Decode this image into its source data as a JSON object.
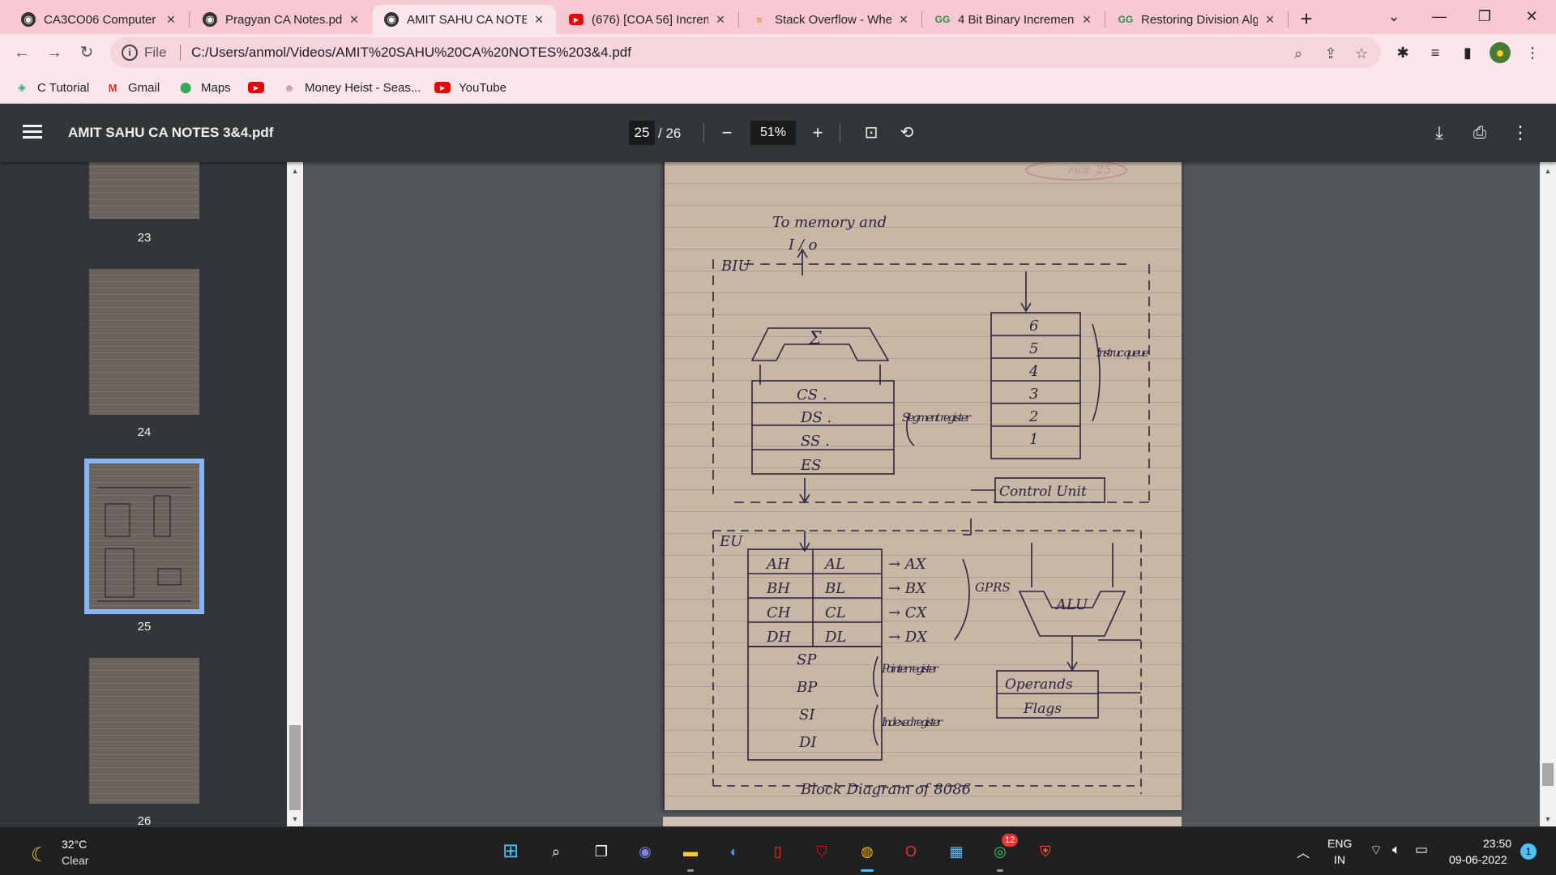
{
  "tabs": [
    {
      "title": "CA3CO06 Computer A",
      "icon": "globe-icon"
    },
    {
      "title": "Pragyan CA Notes.pdf",
      "icon": "globe-icon"
    },
    {
      "title": "AMIT SAHU CA NOTE",
      "icon": "globe-icon",
      "active": true
    },
    {
      "title": "(676) [COA 56] Increm",
      "icon": "youtube-icon"
    },
    {
      "title": "Stack Overflow - Whe",
      "icon": "stackoverflow-icon"
    },
    {
      "title": "4 Bit Binary Increment",
      "icon": "geeksforgeeks-icon"
    },
    {
      "title": "Restoring Division Alg",
      "icon": "geeksforgeeks-icon"
    }
  ],
  "omnibox": {
    "scheme": "File",
    "url": "C:/Users/anmol/Videos/AMIT%20SAHU%20CA%20NOTES%203&4.pdf"
  },
  "bookmarks": [
    {
      "label": "C Tutorial",
      "icon": "ctutorial-icon"
    },
    {
      "label": "Gmail",
      "icon": "gmail-icon"
    },
    {
      "label": "Maps",
      "icon": "maps-icon"
    },
    {
      "label": "",
      "icon": "youtube-icon"
    },
    {
      "label": "Money Heist - Seas...",
      "icon": "site-icon"
    },
    {
      "label": "YouTube",
      "icon": "youtube-icon"
    }
  ],
  "pdf": {
    "title": "AMIT SAHU CA NOTES 3&4.pdf",
    "current_page": "25",
    "total_pages": "/ 26",
    "zoom": "51%"
  },
  "thumbnails": [
    {
      "page": "23"
    },
    {
      "page": "24"
    },
    {
      "page": "25",
      "selected": true
    },
    {
      "page": "26"
    }
  ],
  "notes": {
    "page_mark": "PAGE",
    "page_no": "25",
    "to_memory": "To memory and",
    "io": "I / o",
    "biu": "BIU",
    "sigma": "Σ",
    "seg_regs": [
      "CS .",
      "DS .",
      "SS .",
      "ES"
    ],
    "seg_label": "Segment register",
    "queue": [
      "6",
      "5",
      "4",
      "3",
      "2",
      "1"
    ],
    "queue_label": "Instruc queue",
    "control_unit": "Control Unit",
    "eu": "EU",
    "gpr_rows": [
      [
        "AH",
        "AL",
        "→ AX"
      ],
      [
        "BH",
        "BL",
        "→ BX"
      ],
      [
        "CH",
        "CL",
        "→ CX"
      ],
      [
        "DH",
        "DL",
        "→ DX"
      ]
    ],
    "gpr_label": "GPRS",
    "pointer_regs": [
      "SP",
      "BP"
    ],
    "pointer_label": "Pointer register",
    "index_regs": [
      "SI",
      "DI"
    ],
    "index_label": "Indexed register",
    "alu": "ALU",
    "operands": "Operands",
    "flags": "Flags",
    "caption": "Block Diagram of 8086"
  },
  "taskbar": {
    "temperature": "32°C",
    "condition": "Clear",
    "whatsapp_badge": "12",
    "lang_top": "ENG",
    "lang_bottom": "IN",
    "time": "23:50",
    "date": "09-06-2022",
    "notifications": "1"
  }
}
